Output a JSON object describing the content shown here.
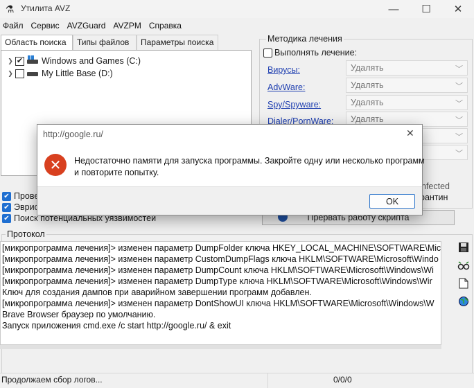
{
  "window": {
    "title": "Утилита AVZ",
    "icon": "avz-icon",
    "controls": {
      "minimize": "—",
      "maximize": "☐",
      "close": "✕"
    }
  },
  "menu": [
    "Файл",
    "Сервис",
    "AVZGuard",
    "AVZPM",
    "Справка"
  ],
  "tabs": [
    "Область поиска",
    "Типы файлов",
    "Параметры поиска"
  ],
  "tree": [
    {
      "label": "Windows and Games  (C:)",
      "checked": true
    },
    {
      "label": "My Little Base (D:)",
      "checked": false
    }
  ],
  "options": [
    "Прове",
    "Эврис",
    "Поиск потенциальных уязвимостей"
  ],
  "method": {
    "legend": "Методика лечения",
    "perform_label": "Выполнять лечение:",
    "rows": [
      {
        "label": "Вирусы:",
        "value": "Удалять"
      },
      {
        "label": "AdvWare:",
        "value": "Удалять"
      },
      {
        "label": "Spy/Spyware:",
        "value": "Удалять"
      },
      {
        "label": "Dialer/PornWare:",
        "value": "Удалять"
      },
      {
        "label": "",
        "value": ""
      },
      {
        "label": "",
        "value": ""
      }
    ],
    "infected_label": "nfected",
    "quarantine_label": "рантин",
    "terminate_button": "Прервать работу скрипта"
  },
  "protocol": {
    "legend": "Протокол",
    "lines": [
      "[микропрограмма лечения]> изменен параметр DumpFolder ключа HKEY_LOCAL_MACHINE\\SOFTWARE\\Micr",
      "[микропрограмма лечения]> изменен параметр CustomDumpFlags ключа HKLM\\SOFTWARE\\Microsoft\\Windo",
      "[микропрограмма лечения]> изменен параметр DumpCount ключа HKLM\\SOFTWARE\\Microsoft\\Windows\\Wi",
      "[микропрограмма лечения]> изменен параметр DumpType ключа HKLM\\SOFTWARE\\Microsoft\\Windows\\Wir",
      "Ключ для создания дампов при аварийном завершении программ добавлен.",
      "[микропрограмма лечения]> изменен параметр DontShowUI ключа HKLM\\SOFTWARE\\Microsoft\\Windows\\W",
      "Brave Browser браузер по умолчанию.",
      "Запуск приложения cmd.exe /c start http://google.ru/ & exit"
    ],
    "side_icons": [
      "save-icon",
      "glasses-icon",
      "page-icon",
      "globe-icon"
    ]
  },
  "status": {
    "text": "Продолжаем сбор логов...",
    "counts": "0/0/0"
  },
  "dialog": {
    "title": "http://google.ru/",
    "close": "✕",
    "message_line1": "Недостаточно памяти для запуска программы. Закройте одну или несколько программ",
    "message_line2": "и повторите попытку.",
    "ok_label": "OK",
    "icon": "error-icon"
  }
}
